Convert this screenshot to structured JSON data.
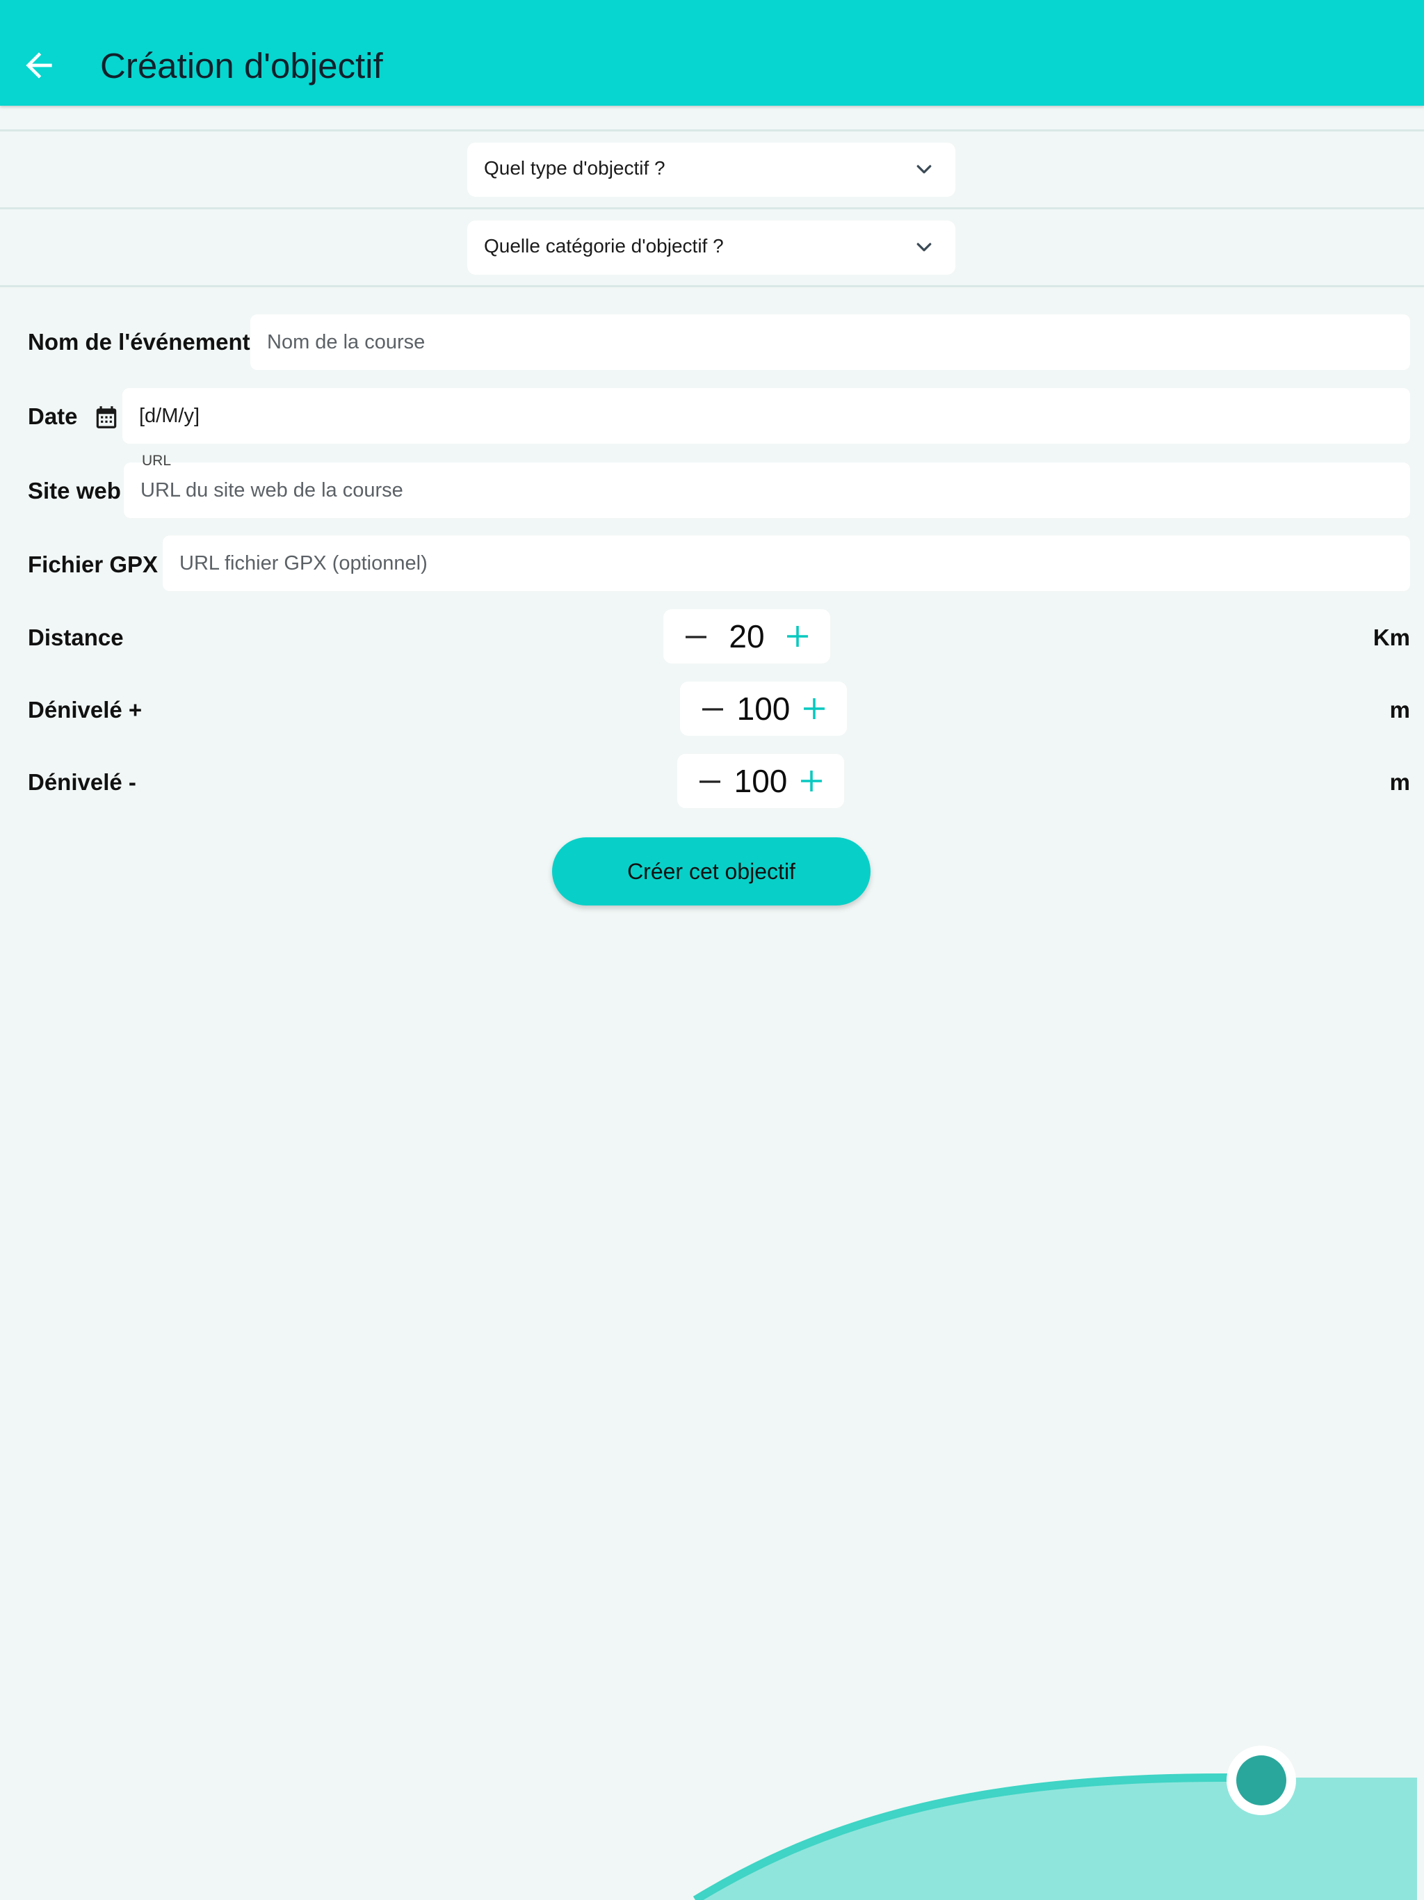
{
  "header": {
    "title": "Création d'objectif",
    "back_icon": "arrow-left-icon"
  },
  "selects": {
    "type_placeholder": "Quel type d'objectif ?",
    "category_placeholder": "Quelle catégorie d'objectif ?"
  },
  "form": {
    "event_name": {
      "label": "Nom de l'événement",
      "placeholder": "Nom de la course",
      "value": ""
    },
    "date": {
      "label": "Date",
      "value": "[d/M/y]",
      "icon": "calendar-icon"
    },
    "website": {
      "label": "Site web",
      "caption": "URL",
      "placeholder": "URL du site web de la course",
      "value": ""
    },
    "gpx": {
      "label": "Fichier GPX",
      "placeholder": "URL fichier GPX (optionnel)",
      "value": ""
    }
  },
  "steppers": {
    "distance": {
      "label": "Distance",
      "value": "20",
      "unit": "Km"
    },
    "elevation_gain": {
      "label": "Dénivelé +",
      "value": "100",
      "unit": "m"
    },
    "elevation_loss": {
      "label": "Dénivelé -",
      "value": "100",
      "unit": "m"
    }
  },
  "submit_label": "Créer cet objectif",
  "colors": {
    "accent": "#06d6cf",
    "background": "#f1f7f6",
    "plus_icon": "#08c9c0",
    "decor_wave": "#8fe5dc",
    "decor_knob": "#2aa79c"
  }
}
